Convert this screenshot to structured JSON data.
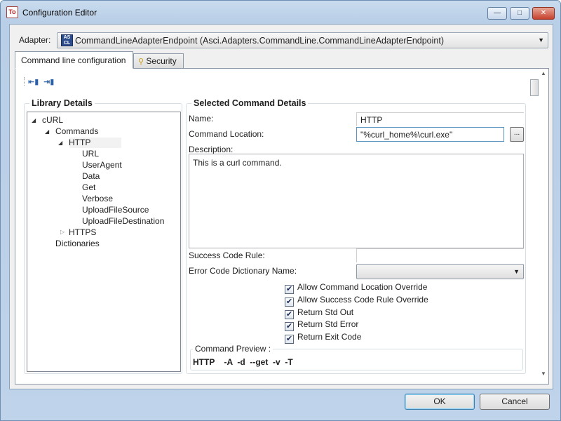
{
  "window": {
    "title": "Configuration Editor",
    "app_icon_text": "To"
  },
  "adapter": {
    "label": "Adapter:",
    "icon_text": "AS CL",
    "selected": "CommandLineAdapterEndpoint (Asci.Adapters.CommandLine.CommandLineAdapterEndpoint)"
  },
  "tabs": [
    {
      "label": "Command line configuration",
      "active": true
    },
    {
      "label": "Security",
      "icon": "key-icon",
      "active": false
    }
  ],
  "library": {
    "title": "Library Details",
    "tree": [
      {
        "label": "cURL",
        "expanded": true
      },
      {
        "label": "Commands",
        "expanded": true
      },
      {
        "label": "HTTP",
        "expanded": true,
        "selected": true
      },
      {
        "label": "URL"
      },
      {
        "label": "UserAgent"
      },
      {
        "label": "Data"
      },
      {
        "label": "Get"
      },
      {
        "label": "Verbose"
      },
      {
        "label": "UploadFileSource"
      },
      {
        "label": "UploadFileDestination"
      },
      {
        "label": "HTTPS",
        "expanded": false
      },
      {
        "label": "Dictionaries"
      }
    ]
  },
  "details": {
    "title": "Selected Command Details",
    "name_label": "Name:",
    "name_value": "HTTP",
    "location_label": "Command Location:",
    "location_value": "\"%curl_home%\\curl.exe\"",
    "browse_label": "...",
    "description_label": "Description:",
    "description_value": "This is a curl command.",
    "success_label": "Success Code Rule:",
    "success_value": "",
    "error_dict_label": "Error Code Dictionary Name:",
    "error_dict_value": "",
    "checkboxes": [
      {
        "label": "Allow Command Location Override",
        "checked": true
      },
      {
        "label": "Allow Success Code Rule Override",
        "checked": true
      },
      {
        "label": "Return Std Out",
        "checked": true
      },
      {
        "label": "Return Std Error",
        "checked": true
      },
      {
        "label": "Return Exit Code",
        "checked": true
      }
    ],
    "preview_label": "Command Preview :",
    "preview_value": "HTTP    -A  -d  --get  -v  -T"
  },
  "buttons": {
    "ok": "OK",
    "cancel": "Cancel"
  },
  "icons": {
    "check": "✔",
    "dropdown": "▼",
    "expanded": "◢",
    "collapsed": "▷"
  }
}
